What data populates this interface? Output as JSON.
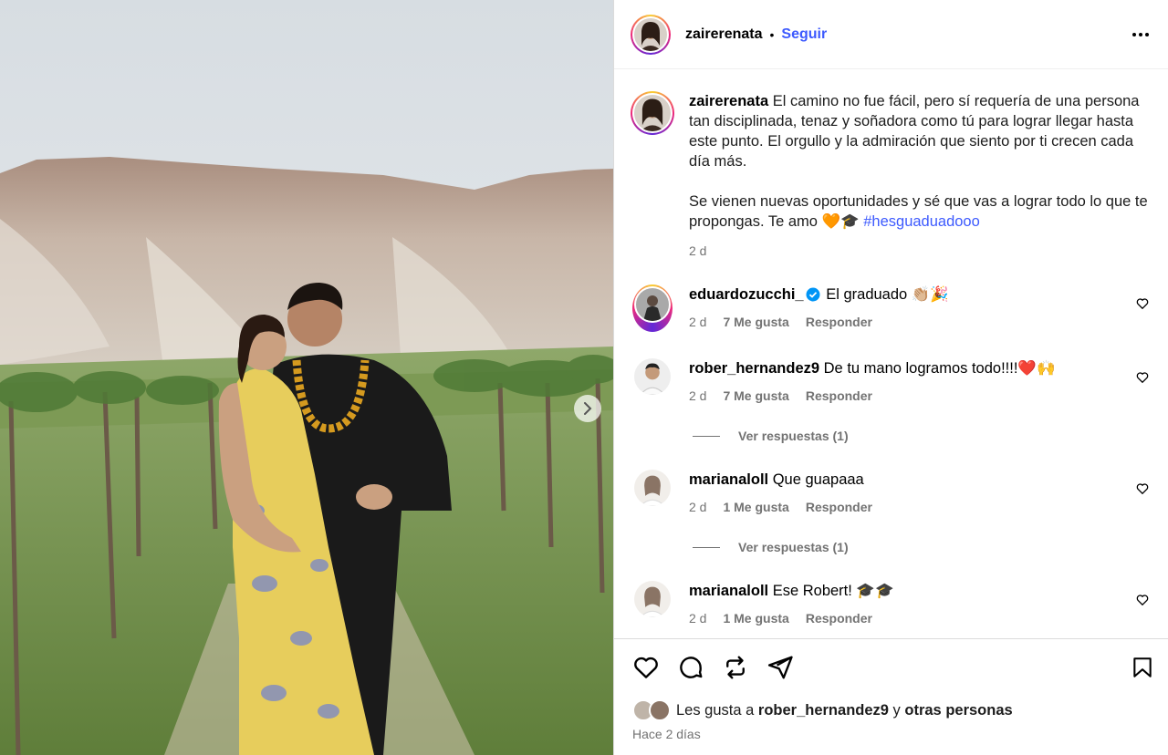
{
  "header": {
    "username": "zairerenata",
    "dot": "•",
    "follow_label": "Seguir"
  },
  "caption": {
    "username": "zairerenata",
    "paragraph1": "El camino no fue fácil, pero sí requería de una persona tan disciplinada, tenaz y soñadora como tú para lograr llegar hasta este punto. El orgullo y la admiración que siento por ti crecen cada día más.",
    "paragraph2": "Se vienen nuevas oportunidades y sé que vas a lograr todo lo que te propongas. Te amo 🧡🎓",
    "hashtag": "#hesguaduadooo",
    "time": "2 d"
  },
  "comments": [
    {
      "username": "eduardozucchi_",
      "verified": true,
      "text": "El graduado 👏🏼🎉",
      "time": "2 d",
      "likes": "7 Me gusta",
      "reply": "Responder"
    },
    {
      "username": "rober_hernandez9",
      "verified": false,
      "text": "De tu mano logramos todo!!!!❤️🙌",
      "time": "2 d",
      "likes": "7 Me gusta",
      "reply": "Responder",
      "view_replies": "Ver respuestas (1)"
    },
    {
      "username": "marianaloll",
      "verified": false,
      "text": "Que guapaaa",
      "time": "2 d",
      "likes": "1 Me gusta",
      "reply": "Responder",
      "view_replies": "Ver respuestas (1)"
    },
    {
      "username": "marianaloll",
      "verified": false,
      "text": "Ese Robert! 🎓🎓",
      "time": "2 d",
      "likes": "1 Me gusta",
      "reply": "Responder"
    }
  ],
  "likes": {
    "prefix": "Les gusta a",
    "user": "rober_hernandez9",
    "middle": "y",
    "others": "otras personas"
  },
  "posted": "Hace 2 días",
  "icons": {
    "like": "heart-icon",
    "comment": "comment-icon",
    "share": "repost-icon",
    "send": "send-icon",
    "save": "bookmark-icon",
    "more": "more-icon",
    "next": "chevron-right-icon"
  },
  "colors": {
    "accent": "#3d5afe",
    "muted": "#737373",
    "border": "#dbdbdb"
  }
}
